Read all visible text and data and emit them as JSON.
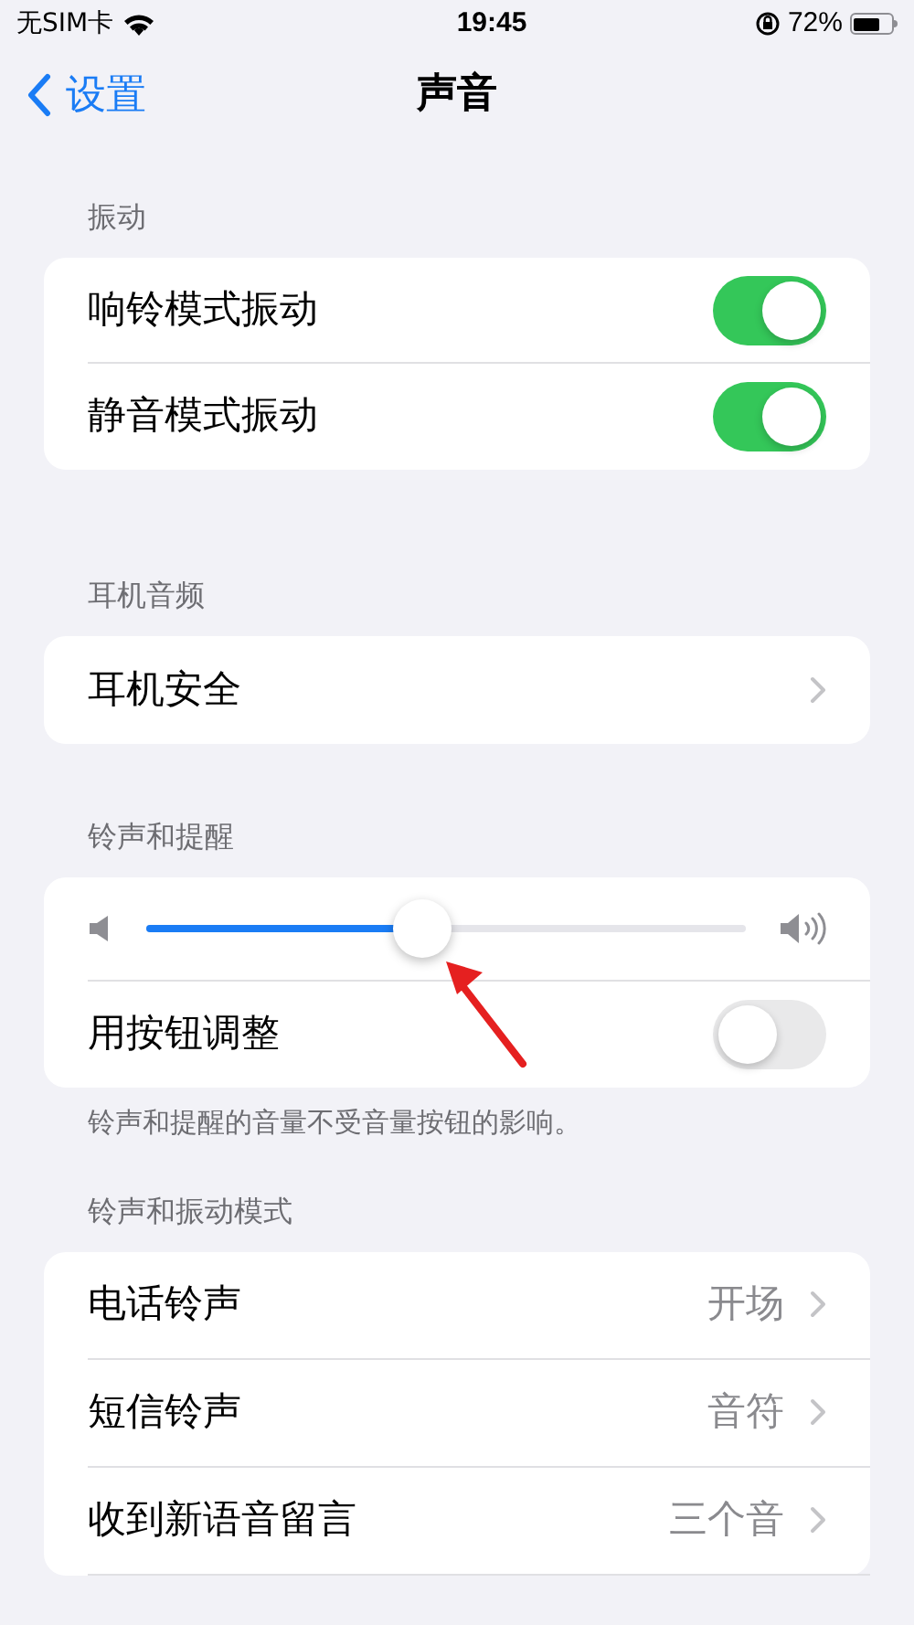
{
  "status_bar": {
    "carrier": "无SIM卡",
    "time": "19:45",
    "battery": "72%"
  },
  "nav": {
    "back": "设置",
    "title": "声音"
  },
  "sections": [
    {
      "header": "振动",
      "rows": [
        {
          "kind": "toggle",
          "label": "响铃模式振动",
          "on": true
        },
        {
          "kind": "toggle",
          "label": "静音模式振动",
          "on": true
        }
      ]
    },
    {
      "header": "耳机音频",
      "rows": [
        {
          "kind": "link",
          "label": "耳机安全"
        }
      ]
    },
    {
      "header": "铃声和提醒",
      "footer": "铃声和提醒的音量不受音量按钮的影响。",
      "rows": [
        {
          "kind": "slider",
          "level": 0.46
        },
        {
          "kind": "toggle",
          "label": "用按钮调整",
          "on": false
        }
      ]
    },
    {
      "header": "铃声和振动模式",
      "rows": [
        {
          "kind": "link",
          "label": "电话铃声",
          "value": "开场"
        },
        {
          "kind": "link",
          "label": "短信铃声",
          "value": "音符"
        },
        {
          "kind": "link",
          "label": "收到新语音留言",
          "value": "三个音"
        }
      ]
    }
  ]
}
